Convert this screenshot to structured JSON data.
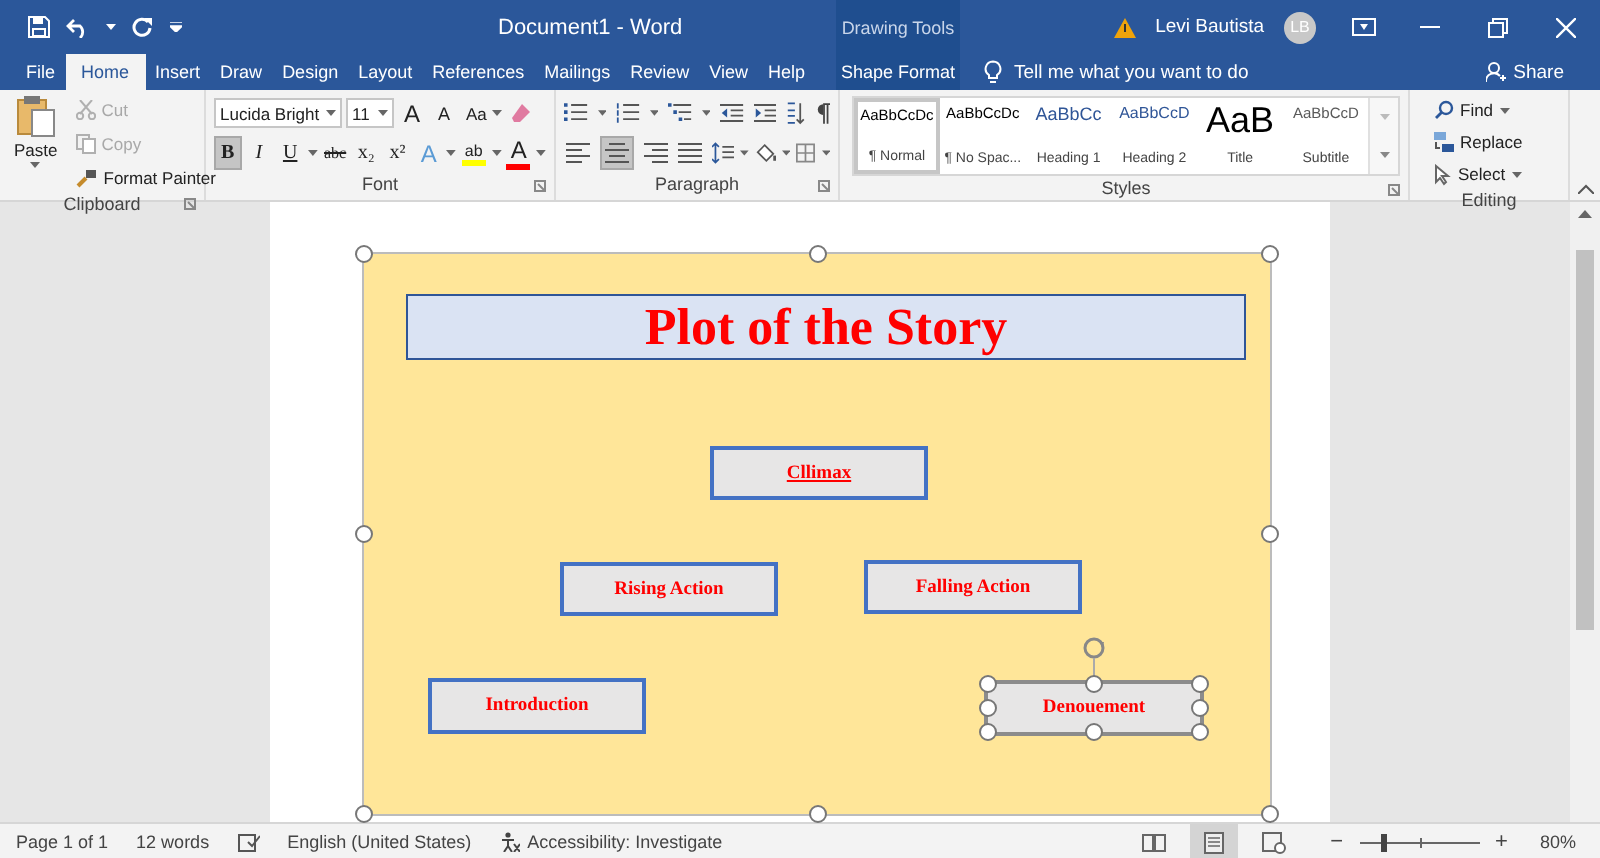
{
  "window": {
    "title": "Document1 - Word",
    "contextual_group": "Drawing Tools",
    "user": "Levi Bautista",
    "avatar": "LB"
  },
  "tabs": [
    {
      "label": "File",
      "selected": false
    },
    {
      "label": "Home",
      "selected": true
    },
    {
      "label": "Insert",
      "selected": false
    },
    {
      "label": "Draw",
      "selected": false
    },
    {
      "label": "Design",
      "selected": false
    },
    {
      "label": "Layout",
      "selected": false
    },
    {
      "label": "References",
      "selected": false
    },
    {
      "label": "Mailings",
      "selected": false
    },
    {
      "label": "Review",
      "selected": false
    },
    {
      "label": "View",
      "selected": false
    },
    {
      "label": "Help",
      "selected": false
    }
  ],
  "contextual_tab": {
    "label": "Shape Format"
  },
  "tell_me": {
    "placeholder": "Tell me what you want to do"
  },
  "share": "Share",
  "ribbon": {
    "clipboard": {
      "label": "Clipboard",
      "paste": "Paste",
      "actions": [
        {
          "kind": "cut",
          "label": "Cut",
          "disabled": true
        },
        {
          "kind": "copy",
          "label": "Copy",
          "disabled": true
        },
        {
          "kind": "painter",
          "label": "Format Painter",
          "disabled": false
        }
      ]
    },
    "font": {
      "label": "Font",
      "name": "Lucida Bright",
      "size": "11",
      "grow": "A",
      "shrink": "A",
      "case": "Aa",
      "formats": [
        {
          "kind": "bold",
          "label": "B",
          "selected": true
        },
        {
          "kind": "italic",
          "label": "I",
          "selected": false
        },
        {
          "kind": "underline",
          "label": "U",
          "selected": false
        },
        {
          "kind": "strike",
          "label": "abc",
          "selected": false
        },
        {
          "kind": "sub",
          "label": "x₂",
          "selected": false
        },
        {
          "kind": "sup",
          "label": "x²",
          "selected": false
        },
        {
          "kind": "effects",
          "label": "A",
          "selected": false
        },
        {
          "kind": "highlight",
          "label": "ab",
          "selected": false
        },
        {
          "kind": "color",
          "label": "A",
          "selected": false
        }
      ]
    },
    "paragraph": {
      "label": "Paragraph",
      "alignment": [
        {
          "kind": "left",
          "selected": false
        },
        {
          "kind": "center",
          "selected": true
        },
        {
          "kind": "right",
          "selected": false
        },
        {
          "kind": "justify",
          "selected": false
        }
      ]
    },
    "styles": {
      "label": "Styles",
      "items": [
        {
          "kind": "normal",
          "preview": "AaBbCcDc",
          "name": "¶ Normal",
          "selected": true
        },
        {
          "kind": "normal",
          "preview": "AaBbCcDc",
          "name": "¶ No Spac...",
          "selected": false
        },
        {
          "kind": "heading1",
          "preview": "AaBbCc",
          "name": "Heading 1",
          "selected": false
        },
        {
          "kind": "heading2",
          "preview": "AaBbCcD",
          "name": "Heading 2",
          "selected": false
        },
        {
          "kind": "title",
          "preview": "AaB",
          "name": "Title",
          "selected": false
        },
        {
          "kind": "subtitle",
          "preview": "AaBbCcD",
          "name": "Subtitle",
          "selected": false
        }
      ]
    },
    "editing": {
      "label": "Editing",
      "actions": [
        {
          "kind": "find",
          "label": "Find"
        },
        {
          "kind": "replace",
          "label": "Replace"
        },
        {
          "kind": "select",
          "label": "Select"
        }
      ]
    }
  },
  "canvas": {
    "selected": true,
    "shapes": [
      {
        "kind": "title",
        "text": "Plot of the Story",
        "selected": false,
        "underlined": false
      },
      {
        "kind": "box",
        "text": "Cllimax",
        "selected": false,
        "underlined": true
      },
      {
        "kind": "box",
        "text": "Rising Action",
        "selected": false,
        "underlined": false
      },
      {
        "kind": "box",
        "text": "Falling Action",
        "selected": false,
        "underlined": false
      },
      {
        "kind": "box",
        "text": "Introduction",
        "selected": false,
        "underlined": false
      },
      {
        "kind": "box",
        "text": "Denouement",
        "selected": true,
        "underlined": false
      }
    ]
  },
  "status_bar": {
    "page": "Page 1 of 1",
    "words": "12 words",
    "language": "English (United States)",
    "accessibility": "Accessibility: Investigate",
    "views": [
      {
        "kind": "read",
        "selected": false
      },
      {
        "kind": "print",
        "selected": true
      },
      {
        "kind": "web",
        "selected": false
      }
    ],
    "zoom_out": "−",
    "zoom_in": "+",
    "zoom": {
      "level": 0.2,
      "reading": "80%"
    }
  }
}
